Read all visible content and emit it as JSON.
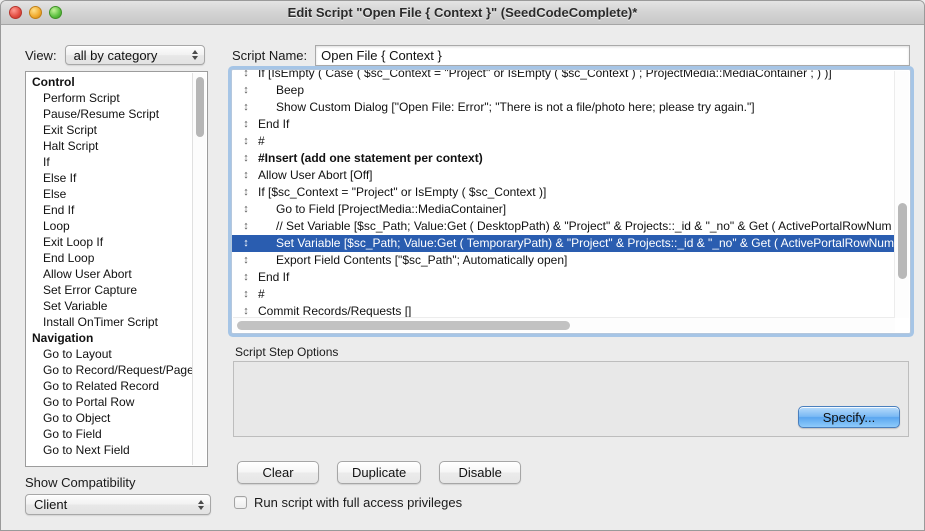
{
  "window": {
    "title": "Edit Script \"Open File { Context }\" (SeedCodeComplete)*",
    "traffic": {
      "close": "close-button",
      "minimize": "minimize-button",
      "zoom": "zoom-button"
    }
  },
  "toolbar": {
    "view_label": "View:",
    "view_value": "all by category",
    "script_name_label": "Script Name:",
    "script_name_value": "Open File { Context }"
  },
  "steps_panel": {
    "groups": [
      {
        "category": "Control",
        "items": [
          "Perform Script",
          "Pause/Resume Script",
          "Exit Script",
          "Halt Script",
          "If",
          "Else If",
          "Else",
          "End If",
          "Loop",
          "Exit Loop If",
          "End Loop",
          "Allow User Abort",
          "Set Error Capture",
          "Set Variable",
          "Install OnTimer Script"
        ]
      },
      {
        "category": "Navigation",
        "items": [
          "Go to Layout",
          "Go to Record/Request/Page",
          "Go to Related Record",
          "Go to Portal Row",
          "Go to Object",
          "Go to Field",
          "Go to Next Field"
        ]
      }
    ]
  },
  "compatibility": {
    "label": "Show Compatibility",
    "value": "Client"
  },
  "script_body": {
    "handle_glyph": "↕",
    "rows": [
      {
        "text": "If [IsEmpty ( Case (        $sc_Context = \"Project\" or IsEmpty ( $sc_Context ) ; ProjectMedia::MediaContainer ; )  )]",
        "indent": 1,
        "selected": false,
        "bold": false
      },
      {
        "text": "Beep",
        "indent": 2,
        "selected": false,
        "bold": false
      },
      {
        "text": "Show Custom Dialog [\"Open File: Error\"; \"There is not a file/photo here; please try again.\"]",
        "indent": 2,
        "selected": false,
        "bold": false
      },
      {
        "text": "End If",
        "indent": 1,
        "selected": false,
        "bold": false
      },
      {
        "text": "#",
        "indent": 1,
        "selected": false,
        "bold": false
      },
      {
        "text": "#Insert (add one statement per context)",
        "indent": 1,
        "selected": false,
        "bold": true
      },
      {
        "text": "Allow User Abort [Off]",
        "indent": 1,
        "selected": false,
        "bold": false
      },
      {
        "text": "If [$sc_Context = \"Project\" or IsEmpty ( $sc_Context )]",
        "indent": 1,
        "selected": false,
        "bold": false
      },
      {
        "text": "Go to Field [ProjectMedia::MediaContainer]",
        "indent": 2,
        "selected": false,
        "bold": false
      },
      {
        "text": "//  Set Variable [$sc_Path; Value:Get ( DesktopPath) & \"Project\" & Projects::_id & \"_no\" & Get ( ActivePortalRowNum",
        "indent": 2,
        "selected": false,
        "bold": false
      },
      {
        "text": "Set Variable [$sc_Path; Value:Get ( TemporaryPath) & \"Project\" & Projects::_id & \"_no\" & Get ( ActivePortalRowNum",
        "indent": 2,
        "selected": true,
        "bold": false
      },
      {
        "text": "Export Field Contents [\"$sc_Path\"; Automatically open]",
        "indent": 2,
        "selected": false,
        "bold": false
      },
      {
        "text": "End If",
        "indent": 1,
        "selected": false,
        "bold": false
      },
      {
        "text": "#",
        "indent": 1,
        "selected": false,
        "bold": false
      },
      {
        "text": "Commit Records/Requests []",
        "indent": 1,
        "selected": false,
        "bold": false
      }
    ]
  },
  "options": {
    "section_label": "Script Step Options",
    "specify_label": "Specify..."
  },
  "actions": {
    "clear": "Clear",
    "duplicate": "Duplicate",
    "disable": "Disable",
    "full_access_label": "Run script with full access privileges",
    "full_access_checked": false
  },
  "colors": {
    "selection": "#2a5db0",
    "focus_ring": "#6ea5e1",
    "window_chrome": "#ececec"
  }
}
